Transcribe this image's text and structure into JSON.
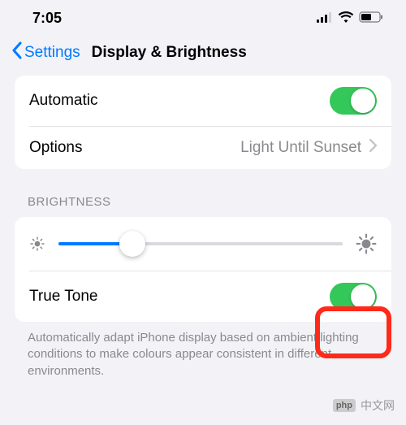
{
  "status": {
    "time": "7:05"
  },
  "nav": {
    "back": "Settings",
    "title": "Display & Brightness"
  },
  "group1": {
    "automatic": {
      "label": "Automatic",
      "on": true
    },
    "options": {
      "label": "Options",
      "value": "Light Until Sunset"
    }
  },
  "brightness": {
    "header": "BRIGHTNESS",
    "slider_pct": 26,
    "truetone": {
      "label": "True Tone",
      "on": true
    },
    "footer": "Automatically adapt iPhone display based on ambient lighting conditions to make colours appear consistent in different environments."
  },
  "watermark": {
    "logo": "php",
    "text": "中文网"
  }
}
